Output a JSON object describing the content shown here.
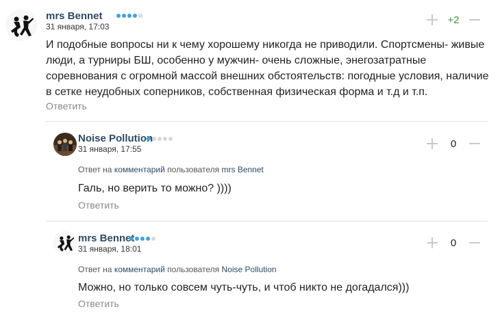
{
  "comments": [
    {
      "author": "mrs Bennet",
      "rating_dots": 4,
      "date": "31 января, 17:03",
      "text": "И подобные вопросы ни к чему хорошему никогда не приводили. Спортсмены- живые люди, а турниры БШ, особенно у мужчин- очень сложные, энегозатратные соревнования с огромной массой внешних обстоятельств: погодные условия, наличие в сетке неудобных соперников, собственная физическая форма и т.д и т.п.",
      "score": "+2",
      "answer_label": "Ответить"
    },
    {
      "author": "Noise Pollution",
      "rating_dots": 1,
      "date": "31 января, 17:55",
      "reply_prefix": "Ответ на",
      "reply_link": "комментарий",
      "reply_mid": "пользователя",
      "reply_user": "mrs Bennet",
      "text": "Галь, но верить то можно? ))))",
      "score": "0",
      "answer_label": "Ответить"
    },
    {
      "author": "mrs Bennet",
      "rating_dots": 4,
      "date": "31 января, 18:01",
      "reply_prefix": "Ответ на",
      "reply_link": "комментарий",
      "reply_mid": "пользователя",
      "reply_user": "Noise Pollution",
      "text": "Можно, но только совсем чуть-чуть, и чтоб никто не догадался)))",
      "score": "0",
      "answer_label": "Ответить"
    }
  ],
  "colors": {
    "author": "#2c4a66",
    "dot_active": "#3ea3e0",
    "dot_inactive": "#d7d7d7",
    "score_positive": "#3a9a3a",
    "muted": "#888888"
  },
  "icons": {
    "avatar_1": "dancing-couple-silhouette",
    "avatar_2": "band-photo",
    "vote_plus": "plus-icon",
    "vote_minus": "minus-icon"
  }
}
